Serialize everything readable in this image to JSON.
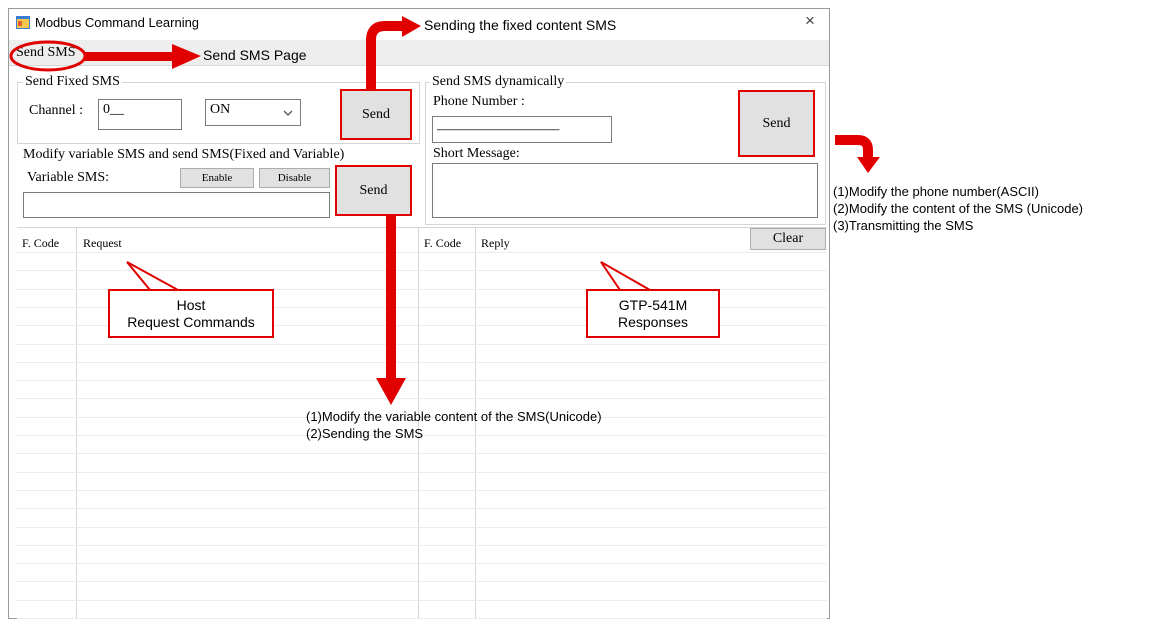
{
  "window": {
    "title": "Modbus Command Learning",
    "close_glyph": "×",
    "icon": "app-window-icon"
  },
  "tab": {
    "label": "Send SMS"
  },
  "fixed_sms": {
    "group_title": "Send Fixed SMS",
    "channel_label": "Channel :",
    "channel_value": "0__",
    "state_value": "ON",
    "send_label": "Send"
  },
  "dynamic_sms": {
    "group_title": "Send SMS dynamically",
    "phone_label": "Phone Number :",
    "phone_value": "____________________",
    "send_label": "Send",
    "message_label": "Short Message:",
    "message_value": ""
  },
  "variable_sms": {
    "group_title": "Modify variable SMS and send SMS(Fixed and Variable)",
    "variable_label": "Variable SMS:",
    "enable_label": "Enable",
    "disable_label": "Disable",
    "send_label": "Send",
    "variable_value": ""
  },
  "request_grid": {
    "col_code": "F. Code",
    "col_request": "Request"
  },
  "reply_grid": {
    "col_code": "F. Code",
    "col_reply": "Reply",
    "clear_label": "Clear"
  },
  "annotations": {
    "send_sms_page": "Send SMS Page",
    "fixed_content": "Sending the fixed content SMS",
    "host_callout": [
      "Host",
      "Request Commands"
    ],
    "gtp_callout": [
      "GTP-541M",
      "Responses"
    ],
    "dynamic_notes": [
      "(1)Modify the phone number(ASCII)",
      "(2)Modify the content of the SMS (Unicode)",
      "(3)Transmitting the SMS"
    ],
    "variable_notes": [
      "(1)Modify the variable content of the SMS(Unicode)",
      "(2)Sending the SMS"
    ]
  },
  "colors": {
    "accent": "#e00000",
    "tabbar": "#eeeeee",
    "button": "#e1e1e1"
  }
}
